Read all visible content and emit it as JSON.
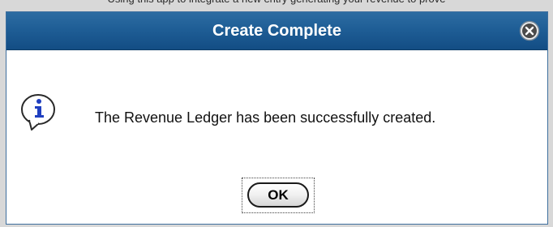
{
  "page": {
    "top_text": "Using this app to integrate a new entry generating your revenue to prove"
  },
  "dialog": {
    "title": "Create Complete",
    "message": "The Revenue Ledger has been successfully created.",
    "ok_label": "OK",
    "icons": {
      "close": "close-icon",
      "info": "info-icon"
    },
    "colors": {
      "titlebar": "#1f5e96",
      "title_text": "#ffffff",
      "background": "#ffffff"
    }
  }
}
